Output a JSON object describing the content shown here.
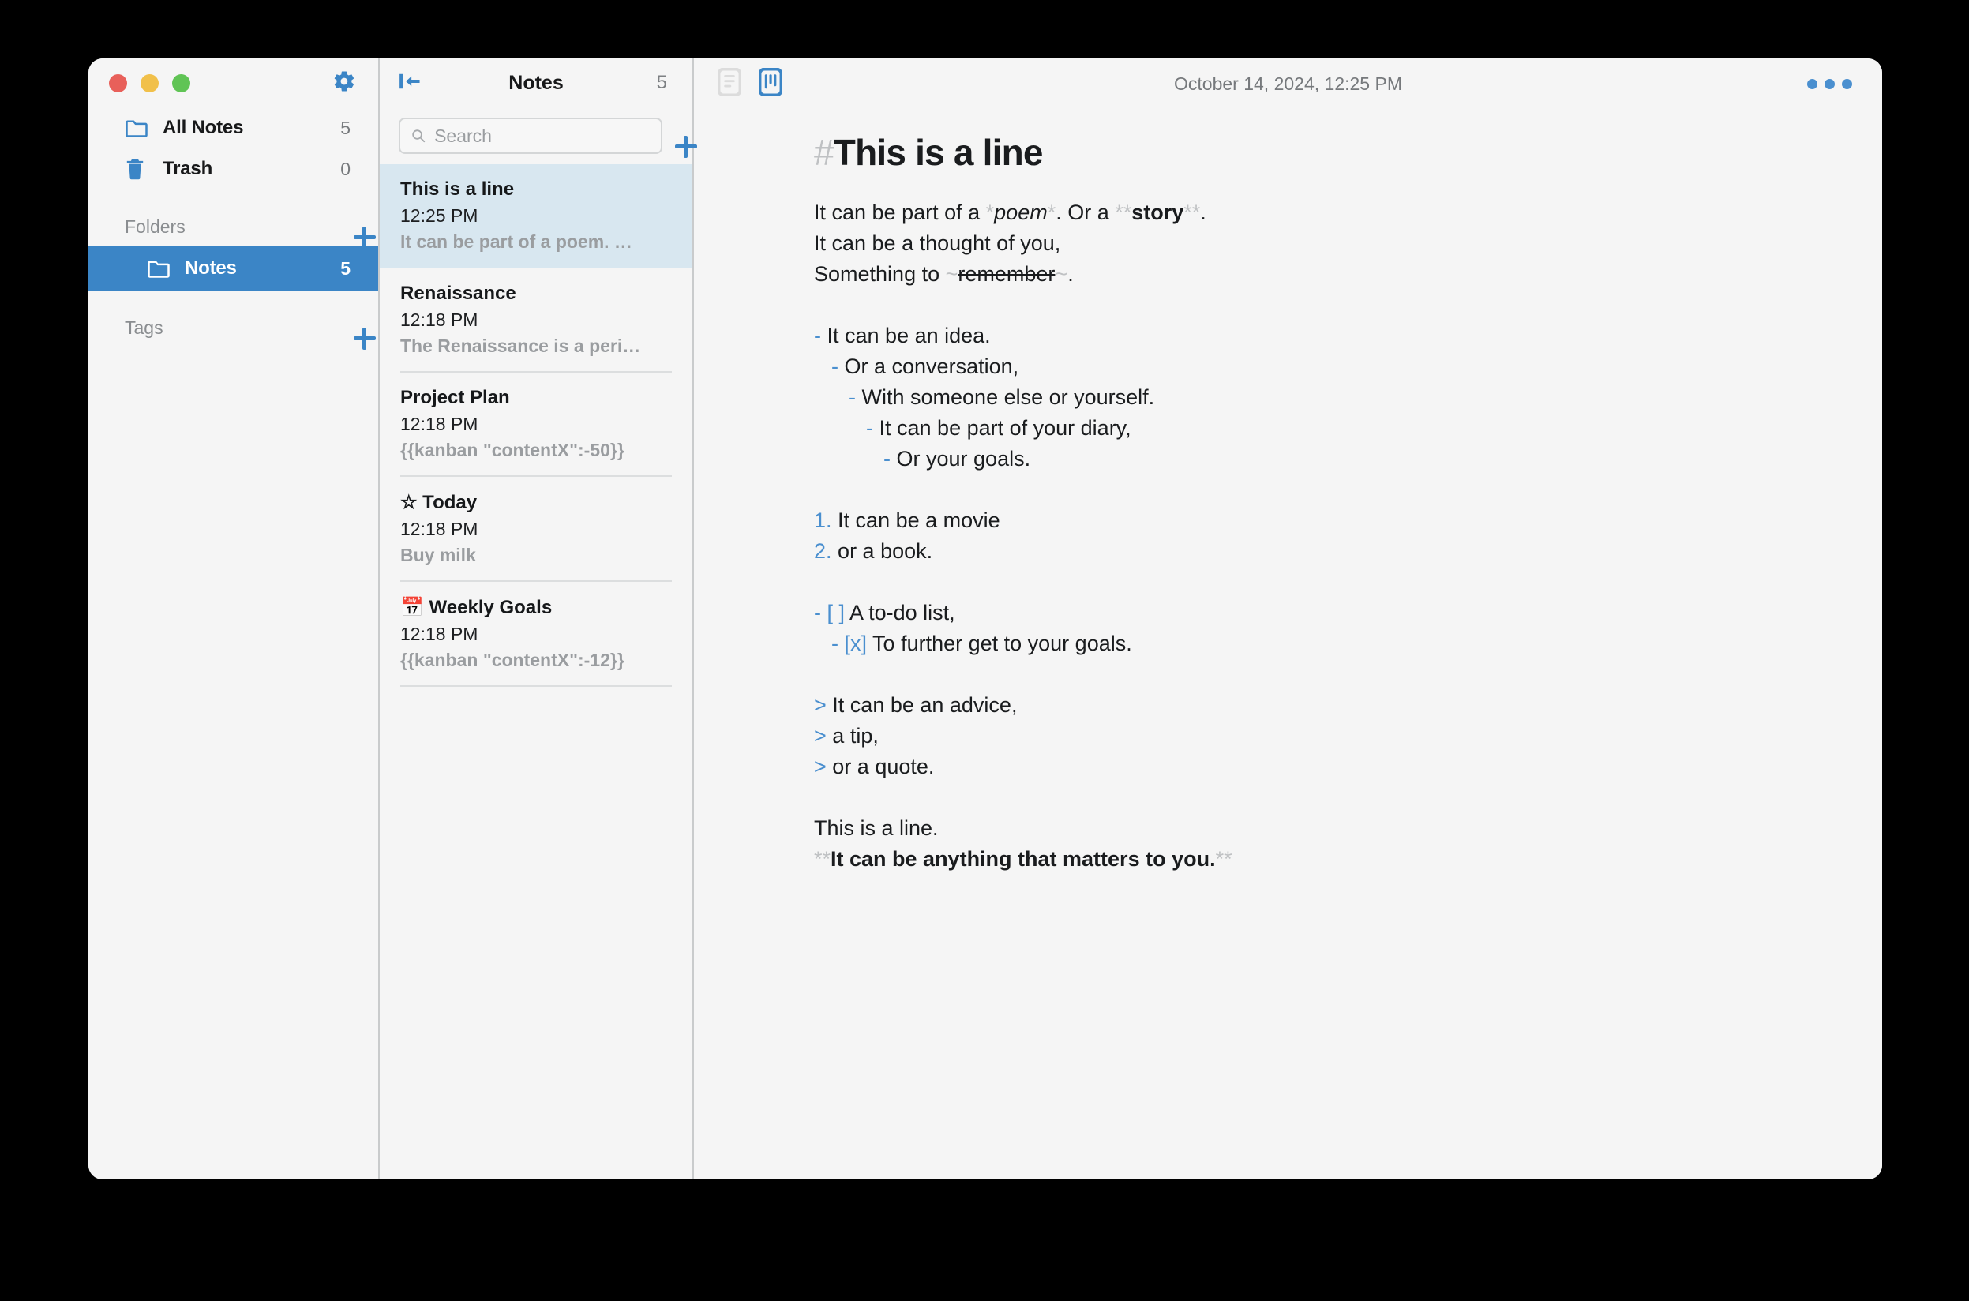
{
  "window": {
    "traffic_lights": [
      "close",
      "minimize",
      "maximize"
    ]
  },
  "sidebar": {
    "gear_icon": "gear-icon",
    "top_items": [
      {
        "icon": "folder-icon",
        "label": "All Notes",
        "count": "5"
      },
      {
        "icon": "trash-icon",
        "label": "Trash",
        "count": "0"
      }
    ],
    "folders_section": {
      "title": "Folders",
      "add_label": "+",
      "items": [
        {
          "icon": "folder-icon",
          "label": "Notes",
          "count": "5",
          "selected": true
        }
      ]
    },
    "tags_section": {
      "title": "Tags",
      "add_label": "+",
      "items": []
    }
  },
  "notes_list": {
    "collapse_icon": "collapse-sidebar-icon",
    "title": "Notes",
    "count": "5",
    "search": {
      "placeholder": "Search",
      "value": ""
    },
    "add_label": "+",
    "items": [
      {
        "title": "This is a line",
        "time": "12:25 PM",
        "preview": "It can be part of a poem. …",
        "selected": true
      },
      {
        "title": "Renaissance",
        "time": "12:18 PM",
        "preview": "The Renaissance is a peri…",
        "selected": false
      },
      {
        "title": "Project Plan",
        "time": "12:18 PM",
        "preview": "{{kanban \"contentX\":-50}}",
        "selected": false
      },
      {
        "title": "☆ Today",
        "time": "12:18 PM",
        "preview": "Buy milk",
        "selected": false
      },
      {
        "title": "📅 Weekly Goals",
        "time": "12:18 PM",
        "preview": "{{kanban \"contentX\":-12}}",
        "selected": false
      }
    ]
  },
  "editor": {
    "toolbar": {
      "note_view_icon": "document-view-icon",
      "board_view_icon": "kanban-board-icon",
      "active_view": "kanban-board-icon",
      "date": "October 14, 2024, 12:25 PM",
      "more_label": "•••"
    },
    "heading": {
      "marker": "#",
      "text": "This is a line"
    },
    "content_lines": [
      {
        "type": "para",
        "parts": [
          {
            "t": "It can be part of a ",
            "s": "plain"
          },
          {
            "t": "*",
            "s": "mk"
          },
          {
            "t": "poem",
            "s": "italic"
          },
          {
            "t": "*",
            "s": "mk"
          },
          {
            "t": ". Or a ",
            "s": "plain"
          },
          {
            "t": "**",
            "s": "mk"
          },
          {
            "t": "story",
            "s": "bold"
          },
          {
            "t": "**",
            "s": "mk"
          },
          {
            "t": ".",
            "s": "plain"
          }
        ]
      },
      {
        "type": "para",
        "parts": [
          {
            "t": "It can be a thought of you,",
            "s": "plain"
          }
        ]
      },
      {
        "type": "para",
        "parts": [
          {
            "t": "Something to ",
            "s": "plain"
          },
          {
            "t": "~",
            "s": "mk"
          },
          {
            "t": "remember",
            "s": "strike"
          },
          {
            "t": "~",
            "s": "mk"
          },
          {
            "t": ".",
            "s": "plain"
          }
        ]
      },
      {
        "type": "blank"
      },
      {
        "type": "bullet",
        "indent": 0,
        "marker": "-",
        "text": "It can be an idea."
      },
      {
        "type": "bullet",
        "indent": 1,
        "marker": "-",
        "text": "Or a conversation,"
      },
      {
        "type": "bullet",
        "indent": 2,
        "marker": "-",
        "text": "With someone else or yourself."
      },
      {
        "type": "bullet",
        "indent": 3,
        "marker": "-",
        "text": "It can be part of your diary,"
      },
      {
        "type": "bullet",
        "indent": 4,
        "marker": "-",
        "text": "Or your goals."
      },
      {
        "type": "blank"
      },
      {
        "type": "ordered",
        "indent": 0,
        "marker": "1.",
        "text": "It can be a movie"
      },
      {
        "type": "ordered",
        "indent": 0,
        "marker": "2.",
        "text": "or a book."
      },
      {
        "type": "blank"
      },
      {
        "type": "todo",
        "indent": 0,
        "marker": "-",
        "box": "[ ]",
        "text": "A to-do list,"
      },
      {
        "type": "todo",
        "indent": 1,
        "marker": "-",
        "box": "[x]",
        "text": "To further get to your goals."
      },
      {
        "type": "blank"
      },
      {
        "type": "quote",
        "marker": ">",
        "text": "It can be an advice,"
      },
      {
        "type": "quote",
        "marker": ">",
        "text": "a tip,"
      },
      {
        "type": "quote",
        "marker": ">",
        "text": "or a quote."
      },
      {
        "type": "blank"
      },
      {
        "type": "para",
        "parts": [
          {
            "t": "This is a line.",
            "s": "plain"
          }
        ]
      },
      {
        "type": "para",
        "parts": [
          {
            "t": "**",
            "s": "mk"
          },
          {
            "t": "It can be anything that matters to you.",
            "s": "bold"
          },
          {
            "t": "**",
            "s": "mk"
          }
        ]
      }
    ]
  },
  "colors": {
    "accent_blue": "#3b85c6",
    "marker_blue": "#4a8fcf",
    "selected_folder_bg": "#3b85c6",
    "selected_note_bg": "#d8e7f0",
    "panel_bg": "#f5f5f5",
    "muted_text": "#9a9da0",
    "markdown_marker": "#bfc1c3"
  }
}
